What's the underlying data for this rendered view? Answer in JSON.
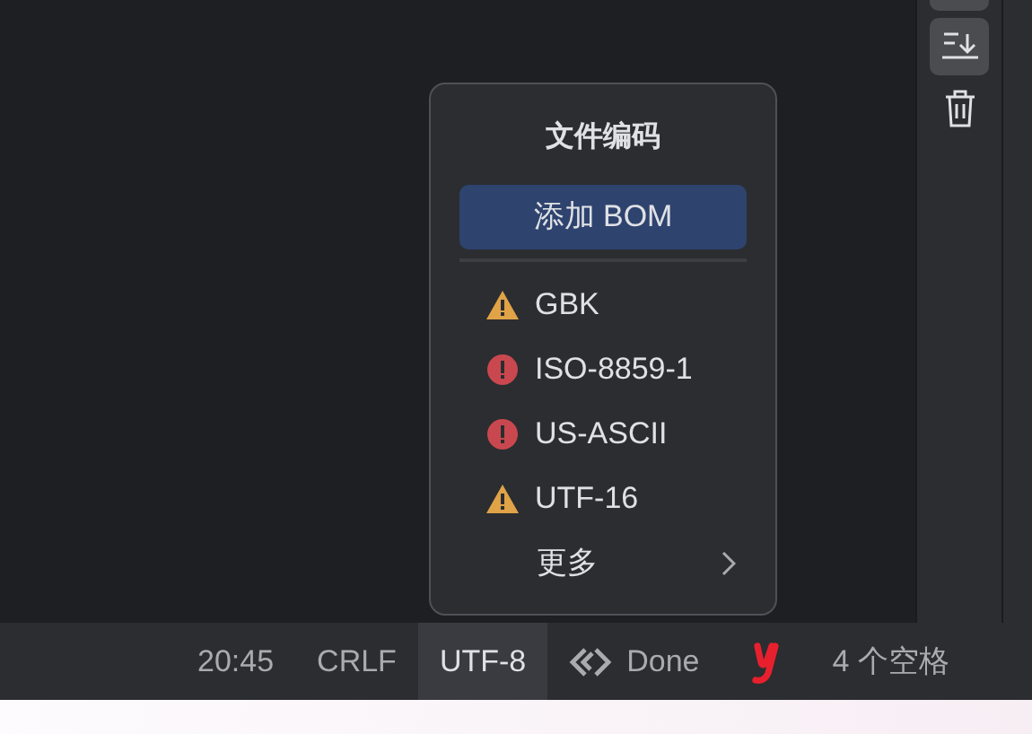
{
  "popup": {
    "title": "文件编码",
    "add_bom_button": "添加 BOM",
    "encodings": [
      {
        "label": "GBK",
        "kind": "warning"
      },
      {
        "label": "ISO-8859-1",
        "kind": "error"
      },
      {
        "label": "US-ASCII",
        "kind": "error"
      },
      {
        "label": "UTF-16",
        "kind": "warning"
      }
    ],
    "more": "更多"
  },
  "status_bar": [
    {
      "text": "20:45",
      "kind": "text",
      "selected": false
    },
    {
      "text": "CRLF",
      "kind": "text",
      "selected": false
    },
    {
      "text": "UTF-8",
      "kind": "text",
      "selected": true
    },
    {
      "text": "Done",
      "kind": "code",
      "selected": false
    },
    {
      "kind": "logo",
      "selected": false
    },
    {
      "text": "4 个空格",
      "kind": "text",
      "selected": false
    }
  ]
}
